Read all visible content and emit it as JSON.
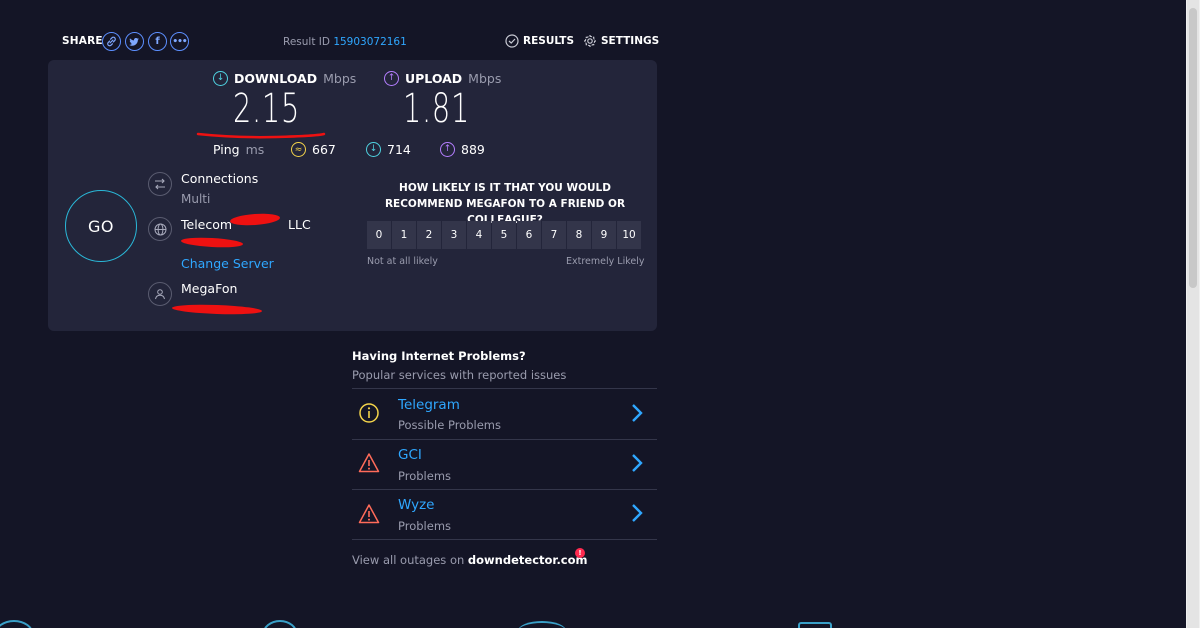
{
  "header": {
    "share_label": "SHARE",
    "share_icons": [
      "link-icon",
      "twitter-icon",
      "facebook-icon",
      "more-icon"
    ],
    "result_id_label": "Result ID",
    "result_id_value": "15903072161",
    "results_label": "RESULTS",
    "settings_label": "SETTINGS"
  },
  "speeds": {
    "download_label": "DOWNLOAD",
    "upload_label": "UPLOAD",
    "unit": "Mbps",
    "download_value": "2.15",
    "upload_value": "1.81"
  },
  "ping": {
    "label": "Ping",
    "unit": "ms",
    "idle": "667",
    "download": "714",
    "upload": "889"
  },
  "go_label": "GO",
  "connections": {
    "title": "Connections",
    "value": "Multi"
  },
  "server": {
    "name_prefix": "Telecom",
    "name_suffix": "LLC",
    "change_label": "Change Server"
  },
  "provider": {
    "name": "MegaFon"
  },
  "survey": {
    "question": "HOW LIKELY IS IT THAT YOU WOULD RECOMMEND MEGAFON TO A FRIEND OR COLLEAGUE?",
    "scale": [
      "0",
      "1",
      "2",
      "3",
      "4",
      "5",
      "6",
      "7",
      "8",
      "9",
      "10"
    ],
    "low_label": "Not at all likely",
    "high_label": "Extremely Likely"
  },
  "problems": {
    "title": "Having Internet Problems?",
    "subtitle": "Popular services with reported issues",
    "items": [
      {
        "name": "Telegram",
        "status": "Possible Problems",
        "icon": "info-icon"
      },
      {
        "name": "GCI",
        "status": "Problems",
        "icon": "warning-icon"
      },
      {
        "name": "Wyze",
        "status": "Problems",
        "icon": "warning-icon"
      }
    ],
    "footer_prefix": "View all outages on",
    "footer_brand": "downdetector.com"
  },
  "colors": {
    "background": "#141526",
    "card": "#23253a",
    "accent_blue": "#2fa7ff",
    "download": "#4fd2e0",
    "upload": "#b47eff",
    "latency": "#f3d34a",
    "warning": "#ff6b5a",
    "redaction": "#ee1111"
  }
}
